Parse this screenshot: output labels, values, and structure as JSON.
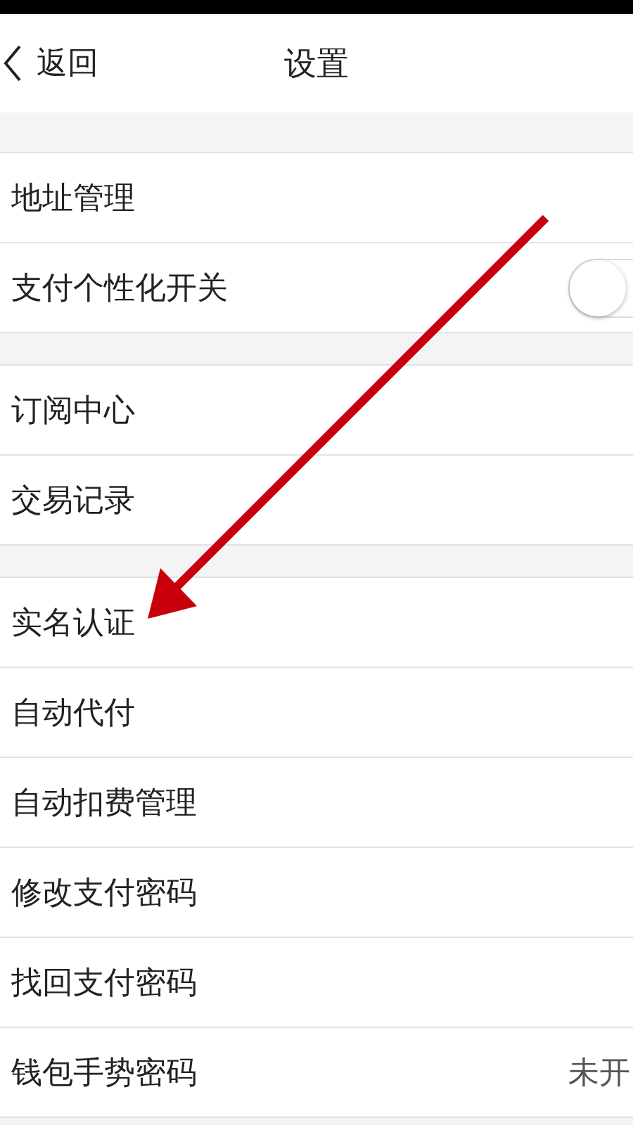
{
  "nav": {
    "back": "返回",
    "title": "设置"
  },
  "groups": [
    {
      "items": [
        {
          "kind": "plain",
          "label": "地址管理"
        },
        {
          "kind": "toggle",
          "label": "支付个性化开关",
          "on": false
        }
      ]
    },
    {
      "items": [
        {
          "kind": "plain",
          "label": "订阅中心"
        },
        {
          "kind": "plain",
          "label": "交易记录"
        }
      ]
    },
    {
      "items": [
        {
          "kind": "plain",
          "label": "实名认证"
        },
        {
          "kind": "plain",
          "label": "自动代付"
        },
        {
          "kind": "plain",
          "label": "自动扣费管理"
        },
        {
          "kind": "plain",
          "label": "修改支付密码"
        },
        {
          "kind": "plain",
          "label": "找回支付密码"
        },
        {
          "kind": "value",
          "label": "钱包手势密码",
          "value": "未开"
        }
      ]
    }
  ]
}
